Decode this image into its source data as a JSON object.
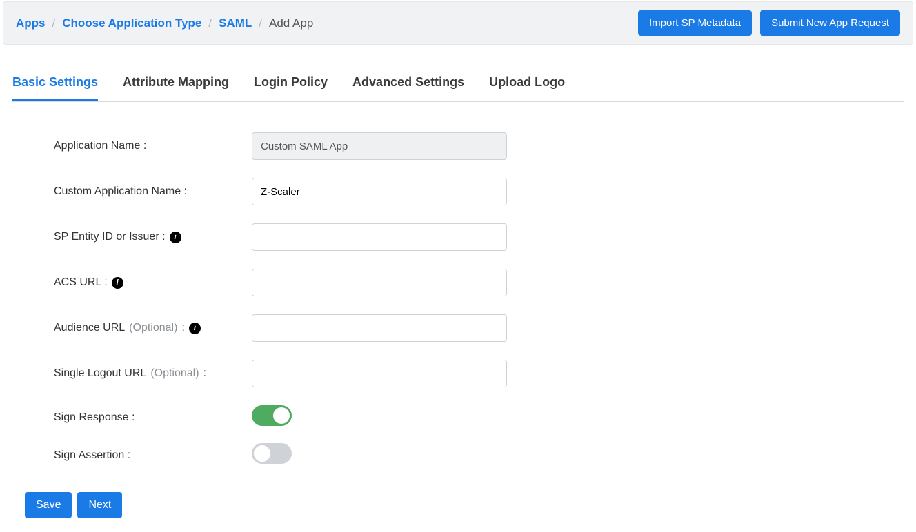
{
  "breadcrumb": {
    "apps": "Apps",
    "choose_type": "Choose Application Type",
    "saml": "SAML",
    "current": "Add App"
  },
  "topbar": {
    "import_metadata": "Import SP Metadata",
    "submit_request": "Submit New App Request"
  },
  "tabs": {
    "basic": "Basic Settings",
    "attribute": "Attribute Mapping",
    "login": "Login Policy",
    "advanced": "Advanced Settings",
    "upload": "Upload Logo"
  },
  "labels": {
    "app_name": "Application Name :",
    "custom_name": "Custom Application Name :",
    "sp_entity": "SP Entity ID or Issuer :",
    "acs_url": "ACS URL :",
    "audience_url_pre": "Audience URL ",
    "optional": "(Optional)",
    "audience_url_post": " :",
    "logout_url_pre": "Single Logout URL ",
    "logout_url_post": " :",
    "sign_response": "Sign Response :",
    "sign_assertion": "Sign Assertion :"
  },
  "values": {
    "app_name": "Custom SAML App",
    "custom_name": "Z-Scaler",
    "sp_entity": "",
    "acs_url": "",
    "audience_url": "",
    "logout_url": "",
    "sign_response": true,
    "sign_assertion": false
  },
  "footer": {
    "save": "Save",
    "next": "Next"
  }
}
